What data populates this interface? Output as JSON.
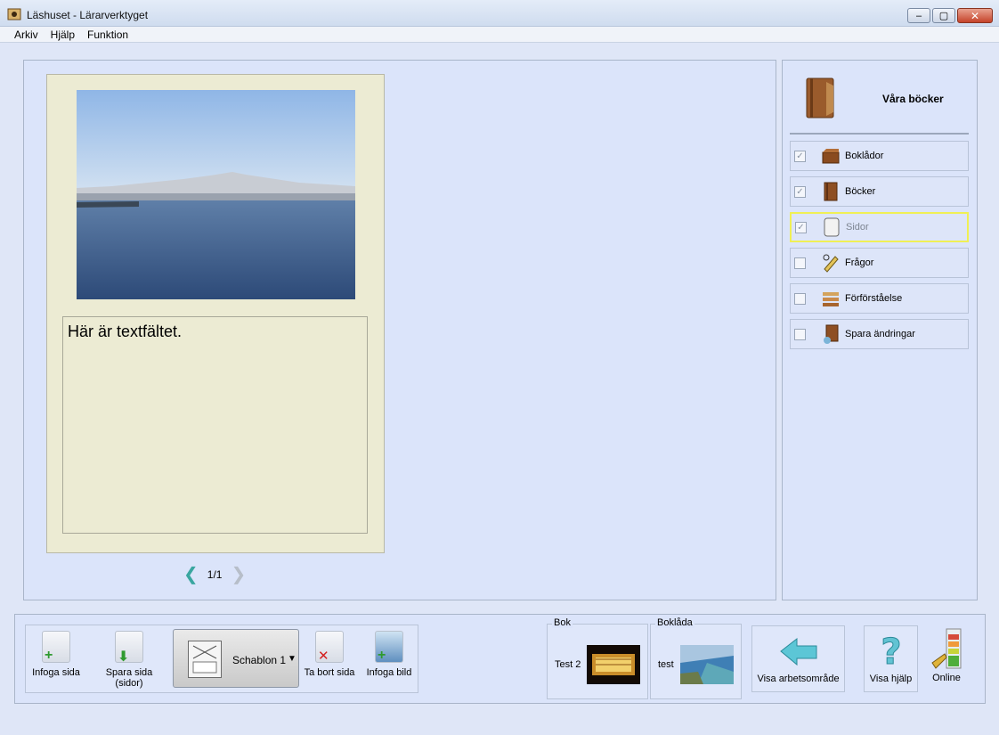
{
  "window": {
    "title": "Läshuset - Lärarverktyget",
    "minimize": "–",
    "maximize": "▢",
    "close": "✕"
  },
  "menu": [
    "Arkiv",
    "Hjälp",
    "Funktion"
  ],
  "page": {
    "text": "Här är textfältet.",
    "pager": "1/1"
  },
  "side": {
    "title": "Våra böcker",
    "items": [
      {
        "label": "Boklådor",
        "checked": true,
        "icon": "box-icon"
      },
      {
        "label": "Böcker",
        "checked": true,
        "icon": "book-icon"
      },
      {
        "label": "Sidor",
        "checked": true,
        "icon": "page-icon"
      },
      {
        "label": "Frågor",
        "checked": false,
        "icon": "quiz-icon"
      },
      {
        "label": "Förförståelse",
        "checked": false,
        "icon": "stack-icon"
      },
      {
        "label": "Spara ändringar",
        "checked": false,
        "icon": "save-book-icon"
      }
    ]
  },
  "toolbar": {
    "insert_page": "Infoga sida",
    "save_page": "Spara sida (sidor)",
    "template": "Schablon 1",
    "delete_page": "Ta bort sida",
    "insert_image": "Infoga bild",
    "book_group": "Bok",
    "book_name": "Test 2",
    "box_group": "Boklåda",
    "box_name": "test",
    "show_workspace": "Visa arbetsområde",
    "show_help": "Visa hjälp",
    "online": "Online"
  }
}
